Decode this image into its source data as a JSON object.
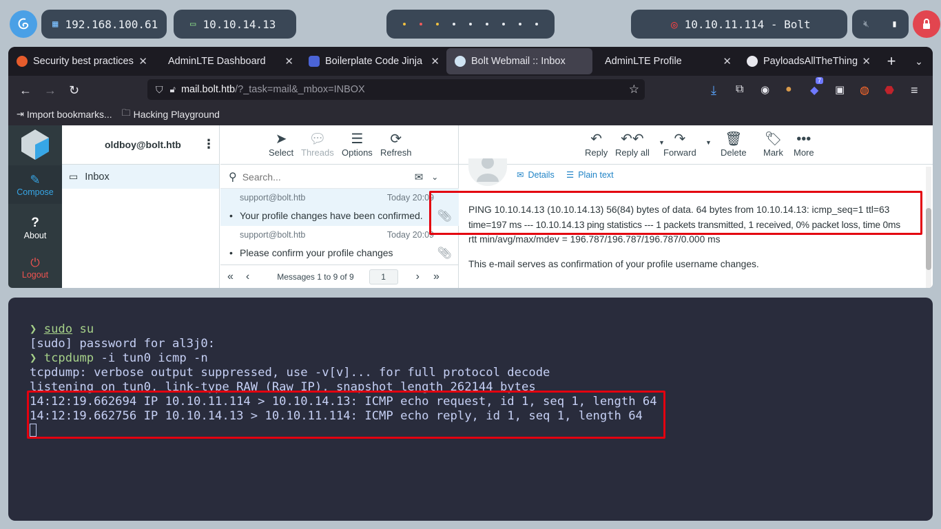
{
  "system_bar": {
    "host_ip": "192.168.100.61",
    "vpn_ip": "10.10.14.13",
    "target": "10.10.11.114 - Bolt"
  },
  "browser": {
    "tabs": [
      {
        "label": "Security best practices",
        "active": false
      },
      {
        "label": "AdminLTE Dashboard",
        "active": false
      },
      {
        "label": "Boilerplate Code Jinja",
        "active": false
      },
      {
        "label": "Bolt Webmail :: Inbox",
        "active": true
      },
      {
        "label": "AdminLTE Profile",
        "active": false
      },
      {
        "label": "PayloadsAllTheThings/",
        "active": false
      }
    ],
    "url_host": "mail.bolt.htb",
    "url_path": "/?_task=mail&_mbox=INBOX",
    "extension_badge": "7",
    "bookmarks": [
      "Import bookmarks...",
      "Hacking Playground"
    ]
  },
  "webmail": {
    "nav": {
      "compose": "Compose",
      "about": "About",
      "logout": "Logout"
    },
    "account": "oldboy@bolt.htb",
    "folders": [
      {
        "label": "Inbox"
      }
    ],
    "list_toolbar": {
      "select": "Select",
      "threads": "Threads",
      "options": "Options",
      "refresh": "Refresh"
    },
    "search_placeholder": "Search...",
    "messages": [
      {
        "from": "support@bolt.htb",
        "date": "Today 20:09",
        "subject": "Your profile changes have been confirmed."
      },
      {
        "from": "support@bolt.htb",
        "date": "Today 20:09",
        "subject": "Please confirm your profile changes"
      }
    ],
    "pagination": {
      "label": "Messages 1 to 9 of 9",
      "page": "1"
    },
    "msg_toolbar": {
      "reply": "Reply",
      "reply_all": "Reply all",
      "forward": "Forward",
      "delete": "Delete",
      "mark": "Mark",
      "more": "More"
    },
    "msg_links": {
      "details": "Details",
      "plain_text": "Plain text"
    },
    "body_line1": "PING 10.10.14.13 (10.10.14.13) 56(84) bytes of data. 64 bytes from 10.10.14.13: icmp_seq=1 ttl=63",
    "body_line2": "time=197 ms --- 10.10.14.13 ping statistics --- 1 packets transmitted, 1 received, 0% packet loss, time 0ms",
    "body_line3": "rtt min/avg/max/mdev = 196.787/196.787/196.787/0.000 ms",
    "body_line4": "This e-mail serves as confirmation of your profile username changes."
  },
  "terminal": {
    "prompt_symbol": "❯",
    "line1_cmd": "sudo",
    "line1_arg": " su",
    "line2": "[sudo] password for al3j0:",
    "line3_cmd": "tcpdump",
    "line3_arg": " -i tun0 icmp -n",
    "line4": "tcpdump: verbose output suppressed, use -v[v]... for full protocol decode",
    "line5": "listening on tun0, link-type RAW (Raw IP), snapshot length 262144 bytes",
    "line6": "14:12:19.662694 IP 10.10.11.114 > 10.10.14.13: ICMP echo request, id 1, seq 1, length 64",
    "line7": "14:12:19.662756 IP 10.10.14.13 > 10.10.11.114: ICMP echo reply, id 1, seq 1, length 64"
  },
  "colors": {
    "highlight_box": "#e3000f",
    "terminal_bg": "#292c3c",
    "webmail_sidebar": "#2f3a3f",
    "accent_blue": "#1f83c6"
  }
}
